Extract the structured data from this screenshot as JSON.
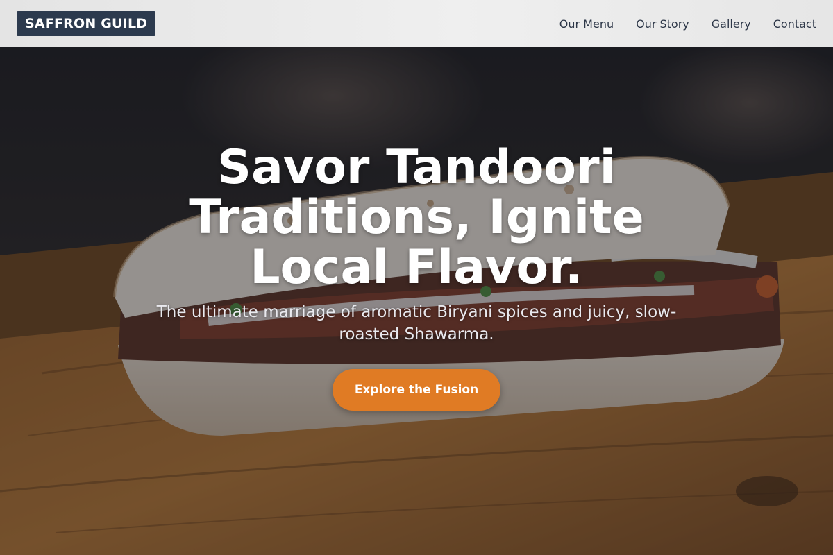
{
  "brand": {
    "name": "SAFFRON GUILD"
  },
  "nav": {
    "items": [
      {
        "label": "Our Menu"
      },
      {
        "label": "Our Story"
      },
      {
        "label": "Gallery"
      },
      {
        "label": "Contact"
      }
    ]
  },
  "hero": {
    "headline": "Savor Tandoori Traditions, Ignite Local Flavor.",
    "subheadline": "The ultimate marriage of aromatic Biryani spices and juicy, slow-roasted Shawarma.",
    "cta_label": "Explore the Fusion",
    "background_image": "shawarma-sandwich-on-wooden-board"
  },
  "colors": {
    "brand_badge": "#2c3a4e",
    "header_bg": "#ececec",
    "nav_text": "#2d3748",
    "cta": "#e07b24",
    "headline": "#ffffff"
  }
}
